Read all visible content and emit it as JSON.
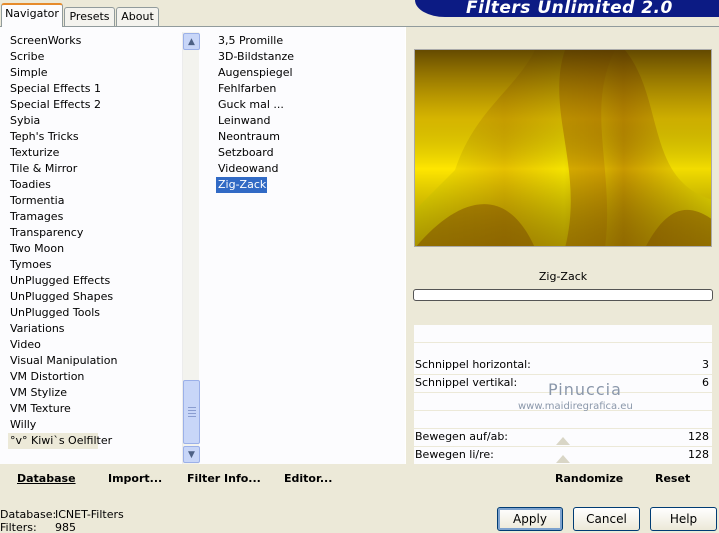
{
  "tabs": [
    "Navigator",
    "Presets",
    "About"
  ],
  "brand": "Filters Unlimited 2.0",
  "categories": [
    "ScreenWorks",
    "Scribe",
    "Simple",
    "Special Effects 1",
    "Special Effects 2",
    "Sybia",
    "Teph's Tricks",
    "Texturize",
    "Tile & Mirror",
    "Toadies",
    "Tormentia",
    "Tramages",
    "Transparency",
    "Two Moon",
    "Tymoes",
    "UnPlugged Effects",
    "UnPlugged Shapes",
    "UnPlugged Tools",
    "Variations",
    "Video",
    "Visual Manipulation",
    "VM Distortion",
    "VM Stylize",
    "VM Texture",
    "Willy",
    "°v° Kiwi`s Oelfilter"
  ],
  "filters": [
    "3,5 Promille",
    "3D-Bildstanze",
    "Augenspiegel",
    "Fehlfarben",
    "Guck mal ...",
    "Leinwand",
    "Neontraum",
    "Setzboard",
    "Videowand",
    "Zig-Zack"
  ],
  "selected_filter_name": "Zig-Zack",
  "params": [
    {
      "label": "Schnippel horizontal:",
      "value": "3"
    },
    {
      "label": "Schnippel vertikal:",
      "value": "6"
    },
    {
      "label": "Bewegen auf/ab:",
      "value": "128"
    },
    {
      "label": "Bewegen li/re:",
      "value": "128"
    }
  ],
  "watermark": {
    "title": "Pinuccia",
    "url": "www.maidiregrafica.eu"
  },
  "toolbar": {
    "database": "Database",
    "import": "Import...",
    "filter_info": "Filter Info...",
    "editor": "Editor...",
    "randomize": "Randomize",
    "reset": "Reset"
  },
  "status": {
    "database_label": "Database:",
    "database_value": "ICNET-Filters",
    "filters_label": "Filters:",
    "filters_value": "985"
  },
  "buttons": {
    "apply": "Apply",
    "cancel": "Cancel",
    "help": "Help"
  },
  "colors": {
    "selection": "#316ac5",
    "brand_bar": "#0c1b84",
    "preview_yellow": "#f5e800",
    "preview_dark": "#5a3b00"
  }
}
